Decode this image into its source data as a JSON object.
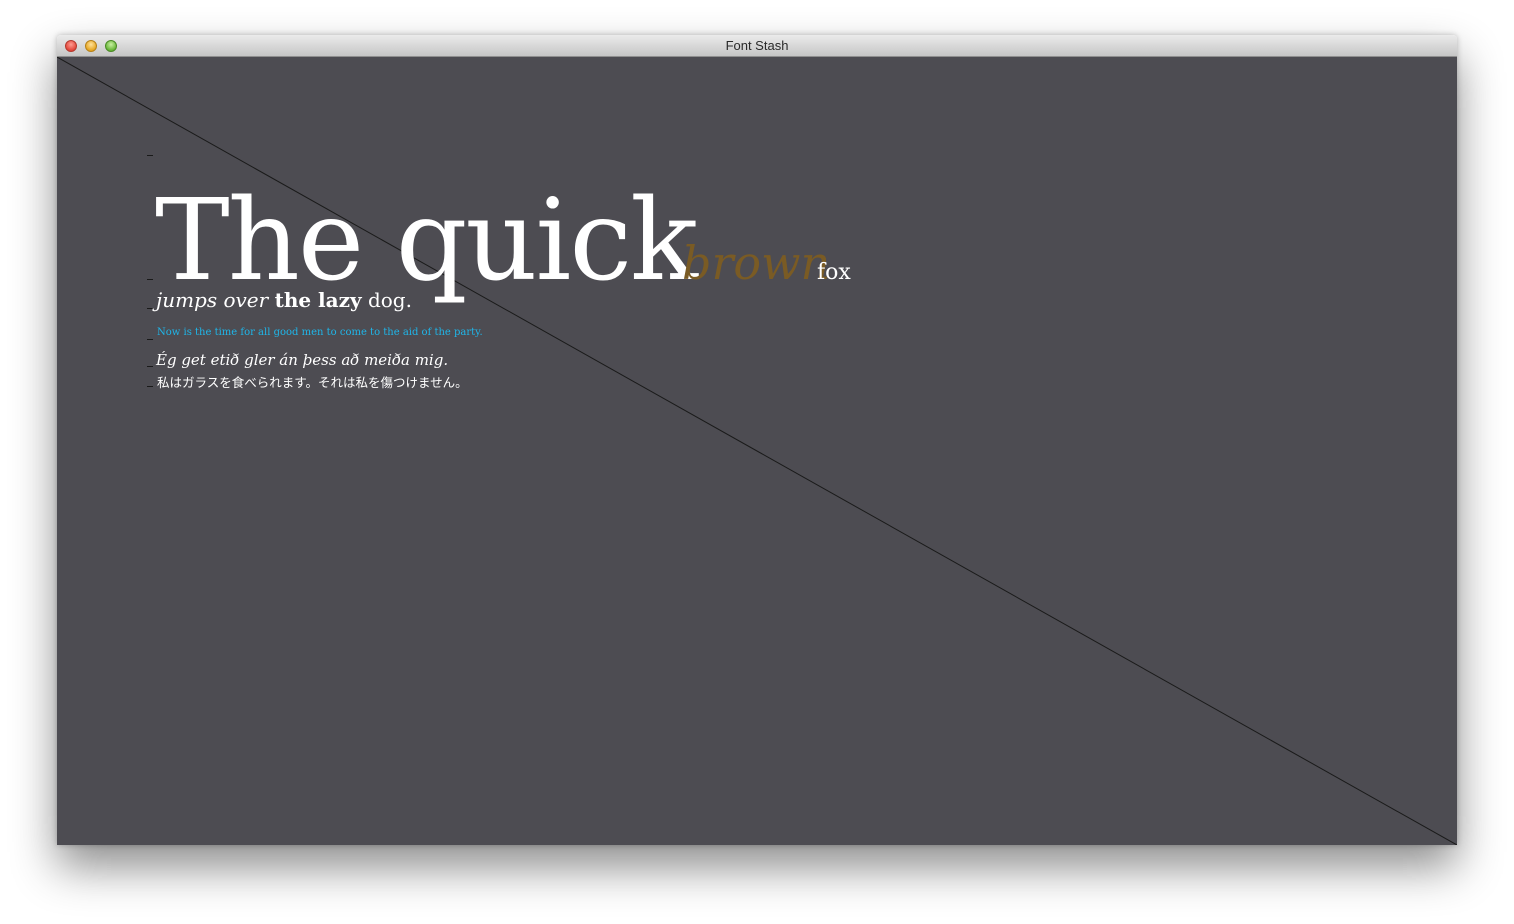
{
  "window": {
    "title": "Font Stash"
  },
  "content": {
    "headline": "The quick",
    "brown": "brown",
    "fox": "fox",
    "line2": {
      "part1": "jumps over",
      "part2": "the lazy",
      "part3": "dog."
    },
    "line3": "Now is the time for all good men to come to the aid of the party.",
    "line4": "Ég get etið gler án þess að meiða mig.",
    "line5": "私はガラスを食べられます。それは私を傷つけません。"
  },
  "colors": {
    "background": "#4d4c52",
    "text": "#ffffff",
    "brown": "#7a5b24",
    "blue": "#1fb5e8",
    "diagonal": "#1a1a1a"
  }
}
